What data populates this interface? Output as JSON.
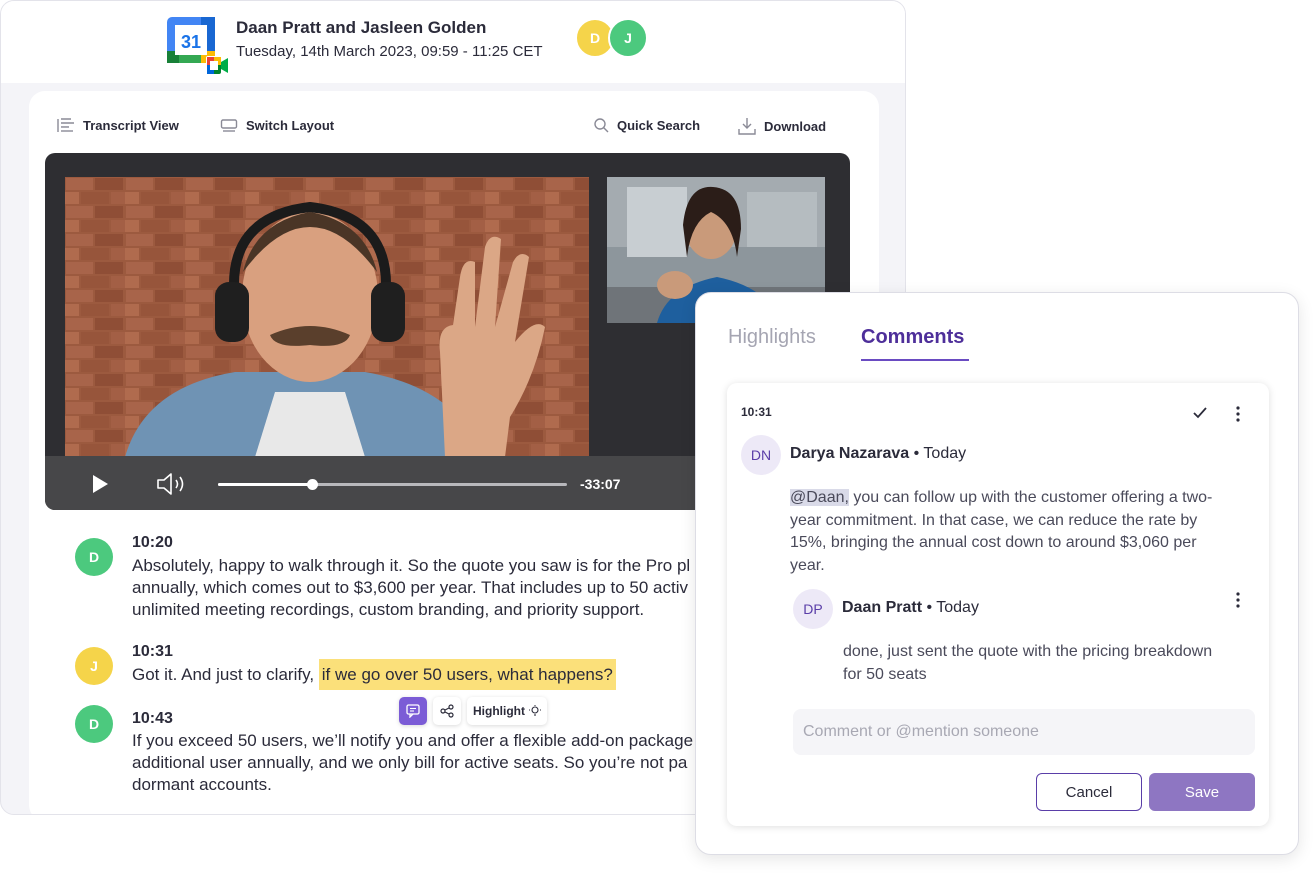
{
  "meeting": {
    "title": "Daan Pratt and Jasleen Golden",
    "datetime": "Tuesday, 14th March 2023, 09:59 - 11:25 CET",
    "calendar_day": "31",
    "participants": [
      {
        "initial": "D",
        "color": "#f5d44a"
      },
      {
        "initial": "J",
        "color": "#4cc97e"
      }
    ]
  },
  "toolbar": {
    "transcript_view": "Transcript View",
    "switch_layout": "Switch Layout",
    "quick_search": "Quick Search",
    "download": "Download"
  },
  "player": {
    "time_remaining": "-33:07",
    "progress_fraction": 0.27
  },
  "transcript": [
    {
      "initial": "D",
      "color": "#4cc97e",
      "time": "10:20",
      "lines": [
        "Absolutely, happy to walk through it. So the quote you saw is for the Pro pl",
        "annually, which comes out to $3,600 per year. That includes up to 50 activ",
        "unlimited meeting recordings, custom branding, and priority support."
      ]
    },
    {
      "initial": "J",
      "color": "#f5d44a",
      "time": "10:31",
      "text_plain": "Got it. And just to clarify, ",
      "text_highlight": "if we go over 50 users, what happens?"
    },
    {
      "initial": "D",
      "color": "#4cc97e",
      "time": "10:43",
      "lines": [
        "If you exceed 50 users, we’ll notify you and offer a flexible add-on package",
        "additional user annually, and we only bill for active seats. So you’re not pa",
        "dormant accounts."
      ]
    }
  ],
  "selection_toolbar": {
    "highlight_label": "Highlight"
  },
  "panel": {
    "tabs": {
      "highlights": "Highlights",
      "comments": "Comments"
    },
    "comment": {
      "time": "10:31",
      "author_initials": "DN",
      "author": "Darya Nazarava",
      "when": "• Today",
      "mention": "@Daan,",
      "lines": [
        " you can follow up with the customer offering a two-",
        "year commitment. In that case, we can reduce the rate by",
        "15%, bringing the annual cost down to around $3,060 per",
        "year."
      ]
    },
    "reply": {
      "author_initials": "DP",
      "author": "Daan Pratt",
      "when": "• Today",
      "lines": [
        "done, just sent the quote with the pricing breakdown",
        "for 50 seats"
      ]
    },
    "input_placeholder": "Comment or @mention someone",
    "cancel_label": "Cancel",
    "save_label": "Save"
  },
  "colors": {
    "accent": "#5a3ea8",
    "highlight": "#fbe07a",
    "save_button": "#8e76c2"
  }
}
